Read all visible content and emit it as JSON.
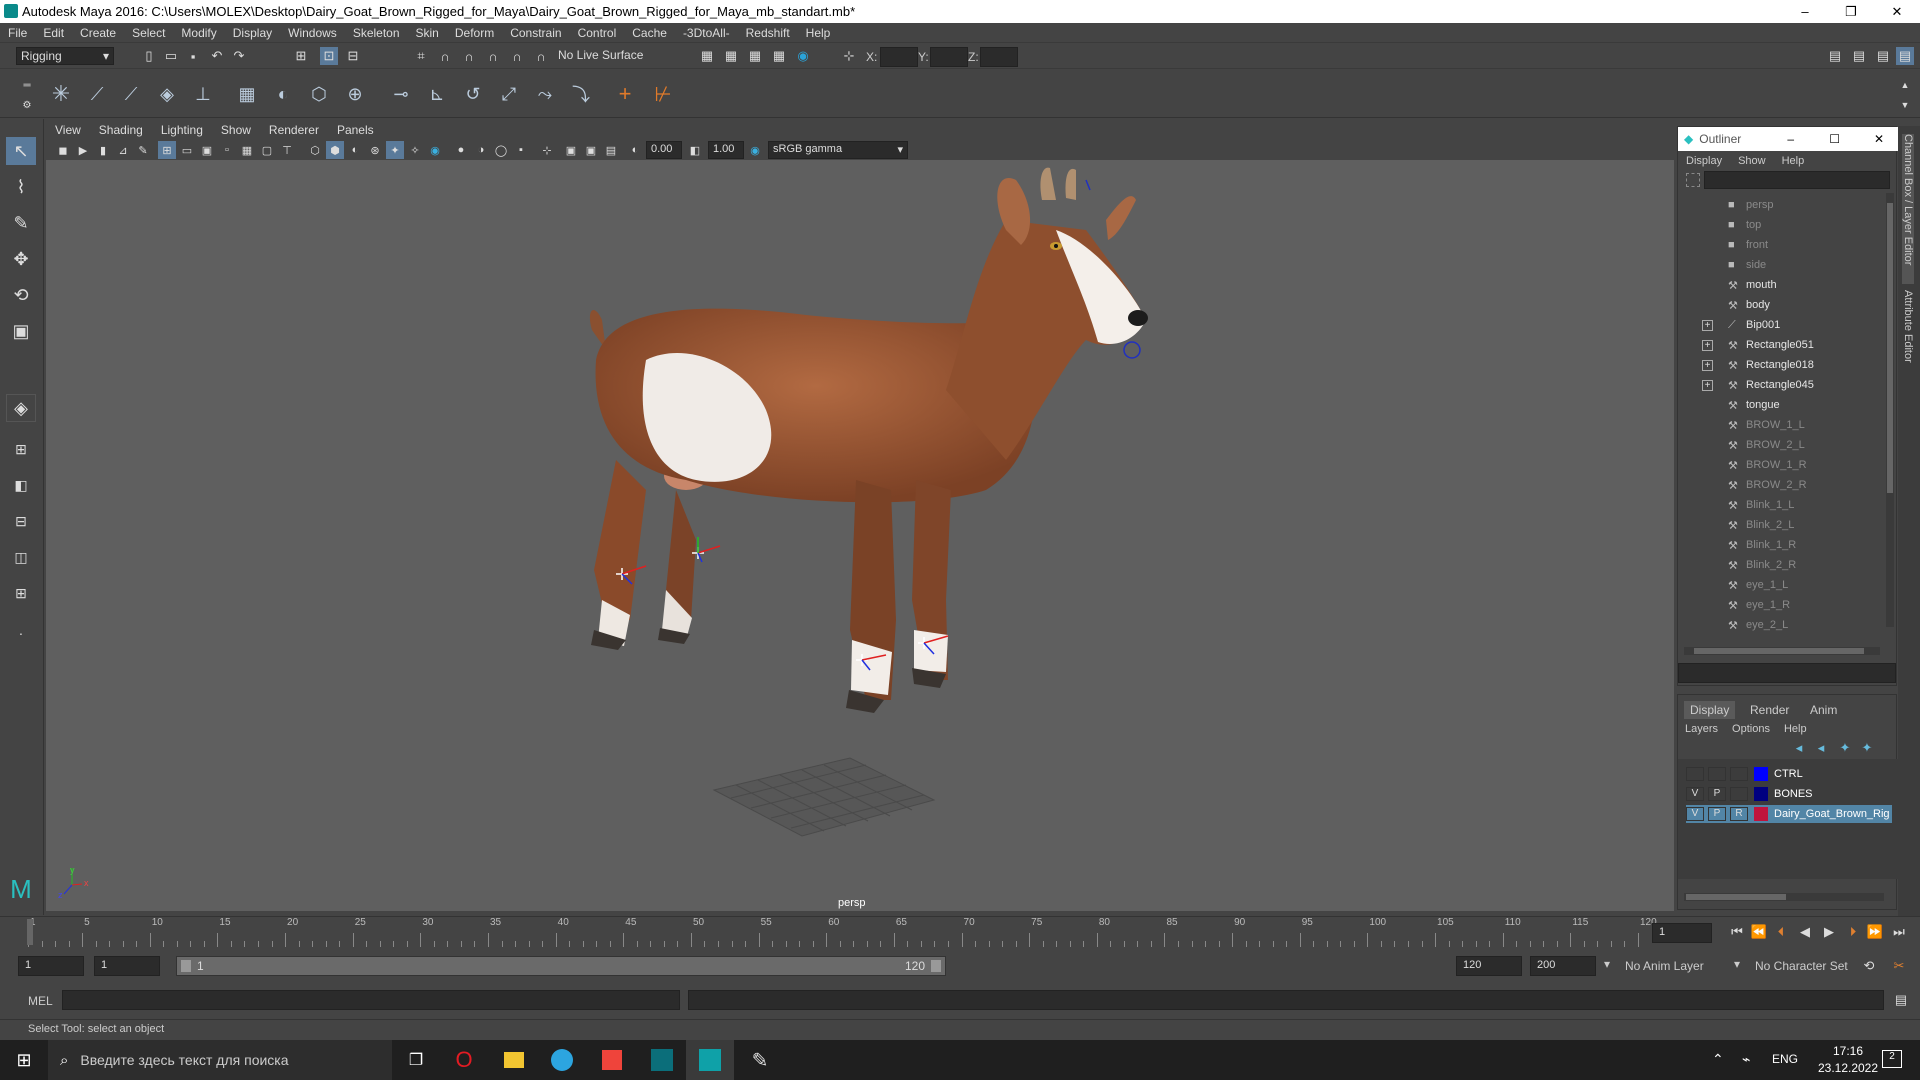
{
  "window": {
    "title": "Autodesk Maya 2016: C:\\Users\\MOLEX\\Desktop\\Dairy_Goat_Brown_Rigged_for_Maya\\Dairy_Goat_Brown_Rigged_for_Maya_mb_standart.mb*",
    "min": "–",
    "max": "❐",
    "close": "✕"
  },
  "menu": [
    "File",
    "Edit",
    "Create",
    "Select",
    "Modify",
    "Display",
    "Windows",
    "Skeleton",
    "Skin",
    "Deform",
    "Constrain",
    "Control",
    "Cache",
    "-3DtoAll-",
    "Redshift",
    "Help"
  ],
  "status": {
    "mode": "Rigging",
    "surface": "No Live Surface",
    "x": "X:",
    "y": "Y:",
    "z": "Z:"
  },
  "viewport": {
    "menu": [
      "View",
      "Shading",
      "Lighting",
      "Show",
      "Renderer",
      "Panels"
    ],
    "exposure": "0.00",
    "gamma": "1.00",
    "colorspace": "sRGB gamma",
    "camera": "persp",
    "axis": {
      "y": "y",
      "x": "x",
      "z": "z"
    }
  },
  "outliner": {
    "title": "Outliner",
    "menu": [
      "Display",
      "Show",
      "Help"
    ],
    "items": [
      {
        "label": "persp",
        "icon": "camera-icon",
        "expand": false,
        "dim": true
      },
      {
        "label": "top",
        "icon": "camera-icon",
        "expand": false,
        "dim": true
      },
      {
        "label": "front",
        "icon": "camera-icon",
        "expand": false,
        "dim": true
      },
      {
        "label": "side",
        "icon": "camera-icon",
        "expand": false,
        "dim": true
      },
      {
        "label": "mouth",
        "icon": "mesh-icon",
        "expand": false,
        "dim": false
      },
      {
        "label": "body",
        "icon": "mesh-icon",
        "expand": false,
        "dim": false
      },
      {
        "label": "Bip001",
        "icon": "joint-icon",
        "expand": true,
        "dim": false
      },
      {
        "label": "Rectangle051",
        "icon": "mesh-icon",
        "expand": true,
        "dim": false
      },
      {
        "label": "Rectangle018",
        "icon": "mesh-icon",
        "expand": true,
        "dim": false
      },
      {
        "label": "Rectangle045",
        "icon": "mesh-icon",
        "expand": true,
        "dim": false
      },
      {
        "label": "tongue",
        "icon": "mesh-icon",
        "expand": false,
        "dim": false
      },
      {
        "label": "BROW_1_L",
        "icon": "mesh-icon",
        "expand": false,
        "dim": true
      },
      {
        "label": "BROW_2_L",
        "icon": "mesh-icon",
        "expand": false,
        "dim": true
      },
      {
        "label": "BROW_1_R",
        "icon": "mesh-icon",
        "expand": false,
        "dim": true
      },
      {
        "label": "BROW_2_R",
        "icon": "mesh-icon",
        "expand": false,
        "dim": true
      },
      {
        "label": "Blink_1_L",
        "icon": "mesh-icon",
        "expand": false,
        "dim": true
      },
      {
        "label": "Blink_2_L",
        "icon": "mesh-icon",
        "expand": false,
        "dim": true
      },
      {
        "label": "Blink_1_R",
        "icon": "mesh-icon",
        "expand": false,
        "dim": true
      },
      {
        "label": "Blink_2_R",
        "icon": "mesh-icon",
        "expand": false,
        "dim": true
      },
      {
        "label": "eye_1_L",
        "icon": "mesh-icon",
        "expand": false,
        "dim": true
      },
      {
        "label": "eye_1_R",
        "icon": "mesh-icon",
        "expand": false,
        "dim": true
      },
      {
        "label": "eye_2_L",
        "icon": "mesh-icon",
        "expand": false,
        "dim": true
      }
    ]
  },
  "layers": {
    "tabs": [
      "Display",
      "Render",
      "Anim"
    ],
    "menu": [
      "Layers",
      "Options",
      "Help"
    ],
    "rows": [
      {
        "v": "",
        "p": "",
        "r": "",
        "color": "#0000ff",
        "name": "CTRL",
        "selected": false
      },
      {
        "v": "V",
        "p": "P",
        "r": "",
        "color": "#000080",
        "name": "BONES",
        "selected": false
      },
      {
        "v": "V",
        "p": "P",
        "r": "R",
        "color": "#c0143c",
        "name": "Dairy_Goat_Brown_Rig",
        "selected": true
      }
    ]
  },
  "rightstrip": {
    "a": "Channel Box / Layer Editor",
    "b": "Attribute Editor"
  },
  "timeline": {
    "ticks": [
      "1",
      "5",
      "10",
      "15",
      "20",
      "25",
      "30",
      "35",
      "40",
      "45",
      "50",
      "55",
      "60",
      "65",
      "70",
      "75",
      "80",
      "85",
      "90",
      "95",
      "100",
      "105",
      "110",
      "115",
      "120"
    ],
    "current": "1"
  },
  "range": {
    "start": "1",
    "startInner": "1",
    "sliderStart": "1",
    "sliderEnd": "120",
    "end": "120",
    "max": "200",
    "animLayer": "No Anim Layer",
    "charSet": "No Character Set"
  },
  "cmd": {
    "label": "MEL"
  },
  "help": "Select Tool: select an object",
  "taskbar": {
    "search": "Введите здесь текст для поиска",
    "lang": "ENG",
    "time": "17:16",
    "date": "23.12.2022",
    "notif": "2"
  }
}
